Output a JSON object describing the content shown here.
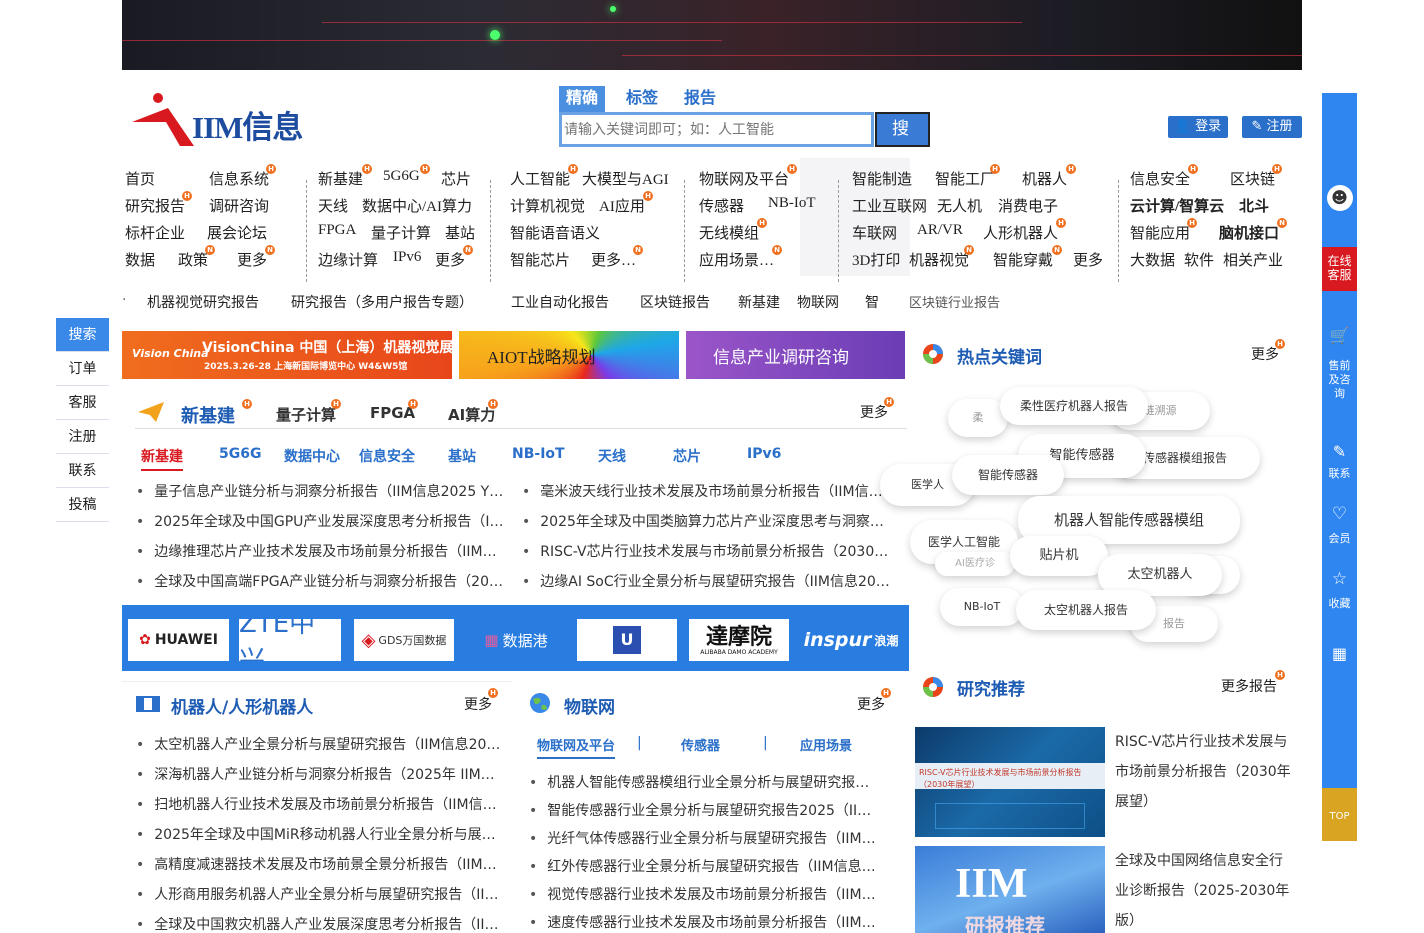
{
  "header": {
    "logo_text": "IIM信息",
    "search_tabs": [
      "精确",
      "标签",
      "报告"
    ],
    "search_placeholder": "请输入关键词即可；如：人工智能",
    "search_button": "搜 索",
    "login": "登录",
    "register": "注册"
  },
  "nav": {
    "c1": [
      [
        "首页",
        "信息系统"
      ],
      [
        "研究报告",
        "调研咨询"
      ],
      [
        "标杆企业",
        "展会论坛"
      ],
      [
        "数据",
        "政策",
        "更多"
      ]
    ],
    "c2": [
      [
        "新基建",
        "5G6G",
        "芯片"
      ],
      [
        "天线",
        "数据中心/AI算力"
      ],
      [
        "FPGA",
        "量子计算",
        "基站"
      ],
      [
        "边缘计算",
        "IPv6",
        "更多"
      ]
    ],
    "c3": [
      [
        "人工智能",
        "大模型与AGI"
      ],
      [
        "计算机视觉",
        "AI应用"
      ],
      [
        "智能语音语义"
      ],
      [
        "智能芯片",
        "更多…"
      ]
    ],
    "c4": [
      [
        "物联网及平台"
      ],
      [
        "传感器",
        "NB-IoT"
      ],
      [
        "无线模组"
      ],
      [
        "应用场景…"
      ]
    ],
    "c5": [
      [
        "智能制造",
        "智能工厂",
        "机器人"
      ],
      [
        "工业互联网",
        "无人机",
        "消费电子"
      ],
      [
        "车联网",
        "AR/VR",
        "人形机器人"
      ],
      [
        "3D打印",
        "机器视觉",
        "智能穿戴",
        "更多"
      ]
    ],
    "c6": [
      [
        "信息安全",
        "区块链"
      ],
      [
        "云计算/智算云",
        "北斗"
      ],
      [
        "智能应用",
        "脑机接口"
      ],
      [
        "大数据",
        "软件",
        "相关产业"
      ]
    ]
  },
  "ticker": [
    "机器视觉研究报告",
    "研究报告（多用户报告专题）",
    "工业自动化报告",
    "区块链报告",
    "新基建",
    "物联网",
    "智",
    "区块链行业报告"
  ],
  "left_nav": [
    "搜索",
    "订单",
    "客服",
    "注册",
    "联系",
    "投稿"
  ],
  "ads": [
    "VisionChina 中国（上海）机器视觉展",
    "2025.3.26-28 上海新国际博览中心 W4&W5馆",
    "AIOT战略规划",
    "信息产业调研咨询"
  ],
  "newinfra": {
    "tabs": [
      "新基建",
      "量子计算",
      "FPGA",
      "AI算力"
    ],
    "more": "更多",
    "subtabs": [
      "新基建",
      "5G6G",
      "数据中心",
      "信息安全",
      "基站",
      "NB-IoT",
      "天线",
      "芯片",
      "IPv6"
    ],
    "left": [
      "量子信息产业链分析与洞察分析报告（IIM信息2025 Y…",
      "2025年全球及中国GPU产业发展深度思考分析报告（I…",
      "边缘推理芯片产业技术发展及市场前景分析报告（IIM…",
      "全球及中国高端FPGA产业链分析与洞察分析报告（20…"
    ],
    "right": [
      "毫米波天线行业技术发展及市场前景分析报告（IIM信…",
      "2025年全球及中国类脑算力芯片产业深度思考与洞察…",
      "RISC-V芯片行业技术发展与市场前景分析报告（2030…",
      "边缘AI SoC行业全景分析与展望研究报告（IIM信息20…"
    ]
  },
  "logos": [
    "HUAWEI",
    "ZTE中兴",
    "GDS万国数据",
    "数据港",
    "U",
    "達摩院",
    "ALIBABA DAMO ACADEMY",
    "inspur",
    "浪潮"
  ],
  "robot": {
    "title": "机器人/人形机器人",
    "more": "更多",
    "items": [
      "太空机器人产业全景分析与展望研究报告（IIM信息20…",
      "深海机器人产业链分析与洞察分析报告（2025年 IIM…",
      "扫地机器人行业技术发展及市场前景分析报告（IIM信…",
      "2025年全球及中国MiR移动机器人行业全景分析与展…",
      "高精度减速器技术发展及市场前景全景分析报告（IIM…",
      "人形商用服务机器人产业全景分析与展望研究报告（II…",
      "全球及中国救灾机器人产业发展深度思考分析报告（II…"
    ]
  },
  "iot": {
    "title": "物联网",
    "more": "更多",
    "subtabs": [
      "物联网及平台",
      "传感器",
      "应用场景"
    ],
    "items": [
      "机器人智能传感器模组行业全景分析与展望研究报…",
      "智能传感器行业全景分析与展望研究报告2025（II…",
      "光纤气体传感器行业全景分析与展望研究报告（IIM…",
      "红外传感器行业全景分析与展望研究报告（IIM信息…",
      "视觉传感器行业技术发展及市场前景分析报告（IIM…",
      "速度传感器行业技术发展及市场前景分析报告（IIM…"
    ]
  },
  "hot": {
    "title": "热点关键词",
    "more": "更多",
    "keywords": [
      "柔性医疗机器人报告",
      "智能传感器",
      "传感器模组报告",
      "智能传感器",
      "医学人",
      "机器人智能传感器模组",
      "医学人工智能",
      "贴片机",
      "太空机器人",
      "NB-IoT",
      "太空机器人报告",
      "柔",
      "链溯源",
      "AI医疗诊",
      "报告",
      "源溯",
      "器人"
    ]
  },
  "research": {
    "title": "研究推荐",
    "more": "更多报告",
    "items": [
      "RISC-V芯片行业技术发展与市场前景分析报告（2030年展望）",
      "全球及中国网络信息安全行业诊断报告（2025-2030年版）"
    ],
    "img1_caption": "RISC-V芯片行业技术发展与市场前景分析报告（2030年展望）",
    "img2_text": "IIM",
    "img2_sub": "研报推荐"
  },
  "right_bar": {
    "service": "在线客服",
    "items": [
      "售前及咨询",
      "联系",
      "会员",
      "收藏"
    ],
    "top": "TOP"
  }
}
